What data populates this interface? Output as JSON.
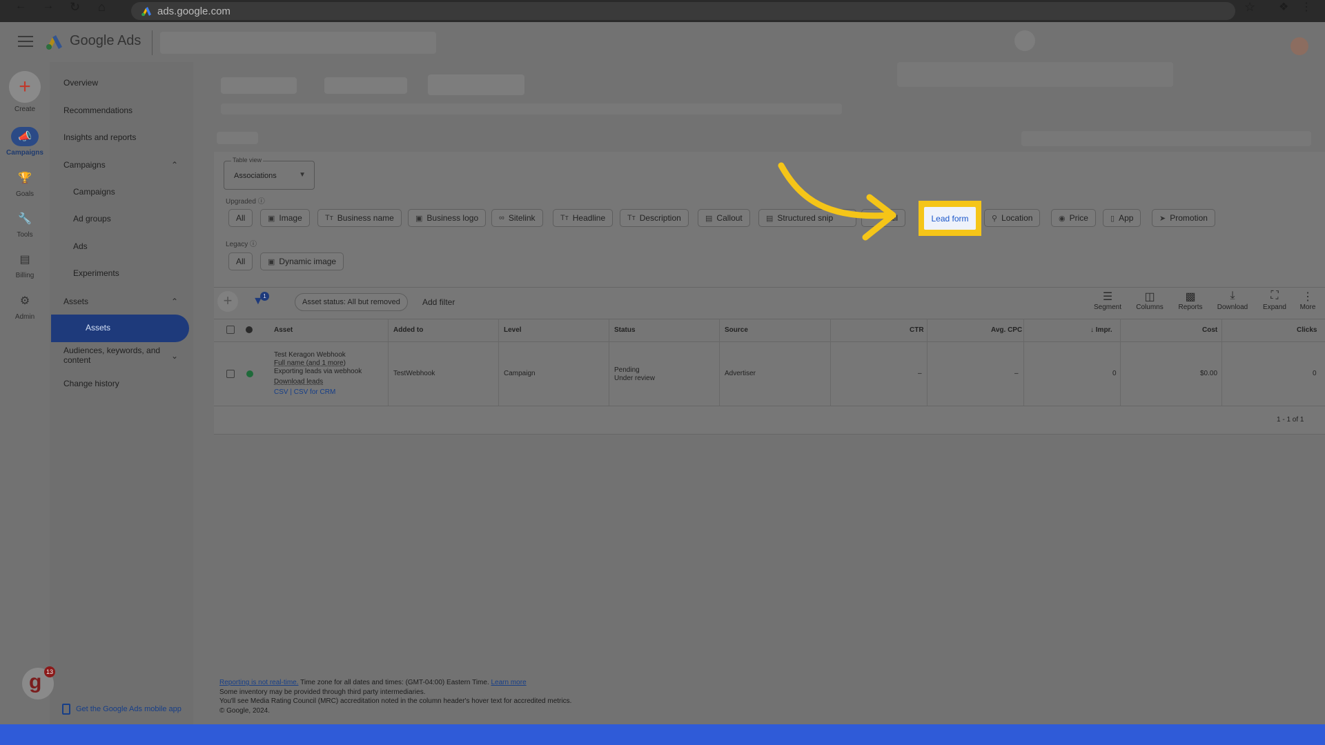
{
  "browser": {
    "url": "ads.google.com"
  },
  "app": {
    "name": "Google Ads"
  },
  "rail": [
    {
      "label": "Create",
      "icon": "plus-icon"
    },
    {
      "label": "Campaigns",
      "icon": "megaphone-icon"
    },
    {
      "label": "Goals",
      "icon": "trophy-icon"
    },
    {
      "label": "Tools",
      "icon": "wrench-icon"
    },
    {
      "label": "Billing",
      "icon": "card-icon"
    },
    {
      "label": "Admin",
      "icon": "gear-icon"
    }
  ],
  "sidebar": {
    "overview": "Overview",
    "recommendations": "Recommendations",
    "insights": "Insights and reports",
    "campaigns_group": "Campaigns",
    "campaigns": "Campaigns",
    "ad_groups": "Ad groups",
    "ads": "Ads",
    "experiments": "Experiments",
    "assets_group": "Assets",
    "assets": "Assets",
    "audiences_line1": "Audiences, keywords, and",
    "audiences_line2": "content",
    "change_history": "Change history"
  },
  "table_view": {
    "label": "Table view",
    "value": "Associations"
  },
  "upgraded": {
    "label": "Upgraded",
    "chips": [
      "All",
      "Image",
      "Business name",
      "Business logo",
      "Sitelink",
      "Headline",
      "Description",
      "Callout",
      "Structured snip",
      "Call",
      "Lead form",
      "Location",
      "Price",
      "App",
      "Promotion"
    ]
  },
  "legacy": {
    "label": "Legacy",
    "chips": [
      "All",
      "Dynamic image"
    ]
  },
  "filters": {
    "badge": "1",
    "status_pill": "Asset status: All but removed",
    "add_filter": "Add filter"
  },
  "tools": [
    "Segment",
    "Columns",
    "Reports",
    "Download",
    "Expand",
    "More"
  ],
  "table": {
    "headers": [
      "Asset",
      "Added to",
      "Level",
      "Status",
      "Source",
      "CTR",
      "Avg. CPC",
      "Impr.",
      "Cost",
      "Clicks"
    ],
    "row": {
      "asset_title": "Test Keragon Webhook",
      "asset_sub": "Full name (and 1 more)",
      "asset_desc": "Exporting leads via webhook",
      "download": "Download leads",
      "csv": "CSV | CSV for CRM",
      "added_to": "TestWebhook",
      "level": "Campaign",
      "status1": "Pending",
      "status2": "Under review",
      "source": "Advertiser",
      "ctr": "–",
      "avg_cpc": "–",
      "impr": "0",
      "cost": "$0.00",
      "clicks": "0"
    },
    "pagination": "1 - 1 of 1"
  },
  "footer": {
    "realtime_link": "Reporting is not real-time.",
    "timezone": " Time zone for all dates and times: (GMT-04:00) Eastern Time. ",
    "learn_more": "Learn more",
    "line2": "Some inventory may be provided through third party intermediaries.",
    "line3": "You'll see Media Rating Council (MRC) accreditation noted in the column header's hover text for accredited metrics.",
    "copyright": "© Google, 2024.",
    "mobile_app": "Get the Google Ads mobile app"
  },
  "extension": {
    "badge": "13"
  },
  "colors": {
    "highlight": "#f5c518",
    "link": "#1a56c9",
    "active_nav": "#1e3a7b"
  }
}
